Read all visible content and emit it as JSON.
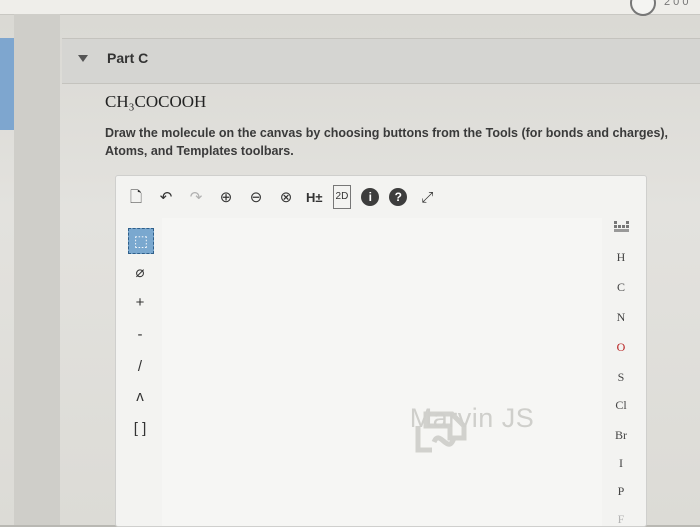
{
  "browser": {
    "page_indicator": "2 0 0"
  },
  "part": {
    "title": "Part C"
  },
  "question": {
    "formula": "CH₃COCOOH",
    "instructions": "Draw the molecule on the canvas by choosing buttons from the Tools (for bonds and charges), Atoms, and Templates toolbars."
  },
  "editor": {
    "top_toolbar": [
      {
        "icon": "new-document-icon",
        "glyph": "🗋"
      },
      {
        "icon": "undo-icon",
        "glyph": "↶"
      },
      {
        "icon": "redo-icon",
        "glyph": "↷"
      },
      {
        "icon": "zoom-in-icon",
        "glyph": "⊕"
      },
      {
        "icon": "zoom-out-icon",
        "glyph": "⊖"
      },
      {
        "icon": "zoom-reset-icon",
        "glyph": "⊗"
      },
      {
        "icon": "explicit-hydrogens-icon",
        "glyph": "H±"
      },
      {
        "icon": "clean-2d-icon",
        "glyph": "2D"
      },
      {
        "icon": "info-icon",
        "glyph": "i"
      },
      {
        "icon": "help-icon",
        "glyph": "?"
      },
      {
        "icon": "fullscreen-icon",
        "glyph": "⤢"
      }
    ],
    "left_toolbar": [
      {
        "icon": "selection-icon",
        "glyph": "⬚"
      },
      {
        "icon": "eraser-icon",
        "glyph": "⌀"
      },
      {
        "icon": "increase-charge-icon",
        "glyph": "+"
      },
      {
        "icon": "decrease-charge-icon",
        "glyph": "-"
      },
      {
        "icon": "single-bond-icon",
        "glyph": "/"
      },
      {
        "icon": "chain-icon",
        "glyph": "ʌ"
      },
      {
        "icon": "bracket-icon",
        "glyph": "[ ]"
      }
    ],
    "periodic_table_icon": "periodic-table-icon",
    "atoms": [
      "H",
      "C",
      "N",
      "O",
      "S",
      "Cl",
      "Br",
      "I",
      "P",
      "F"
    ],
    "watermark": "Marvin JS"
  }
}
